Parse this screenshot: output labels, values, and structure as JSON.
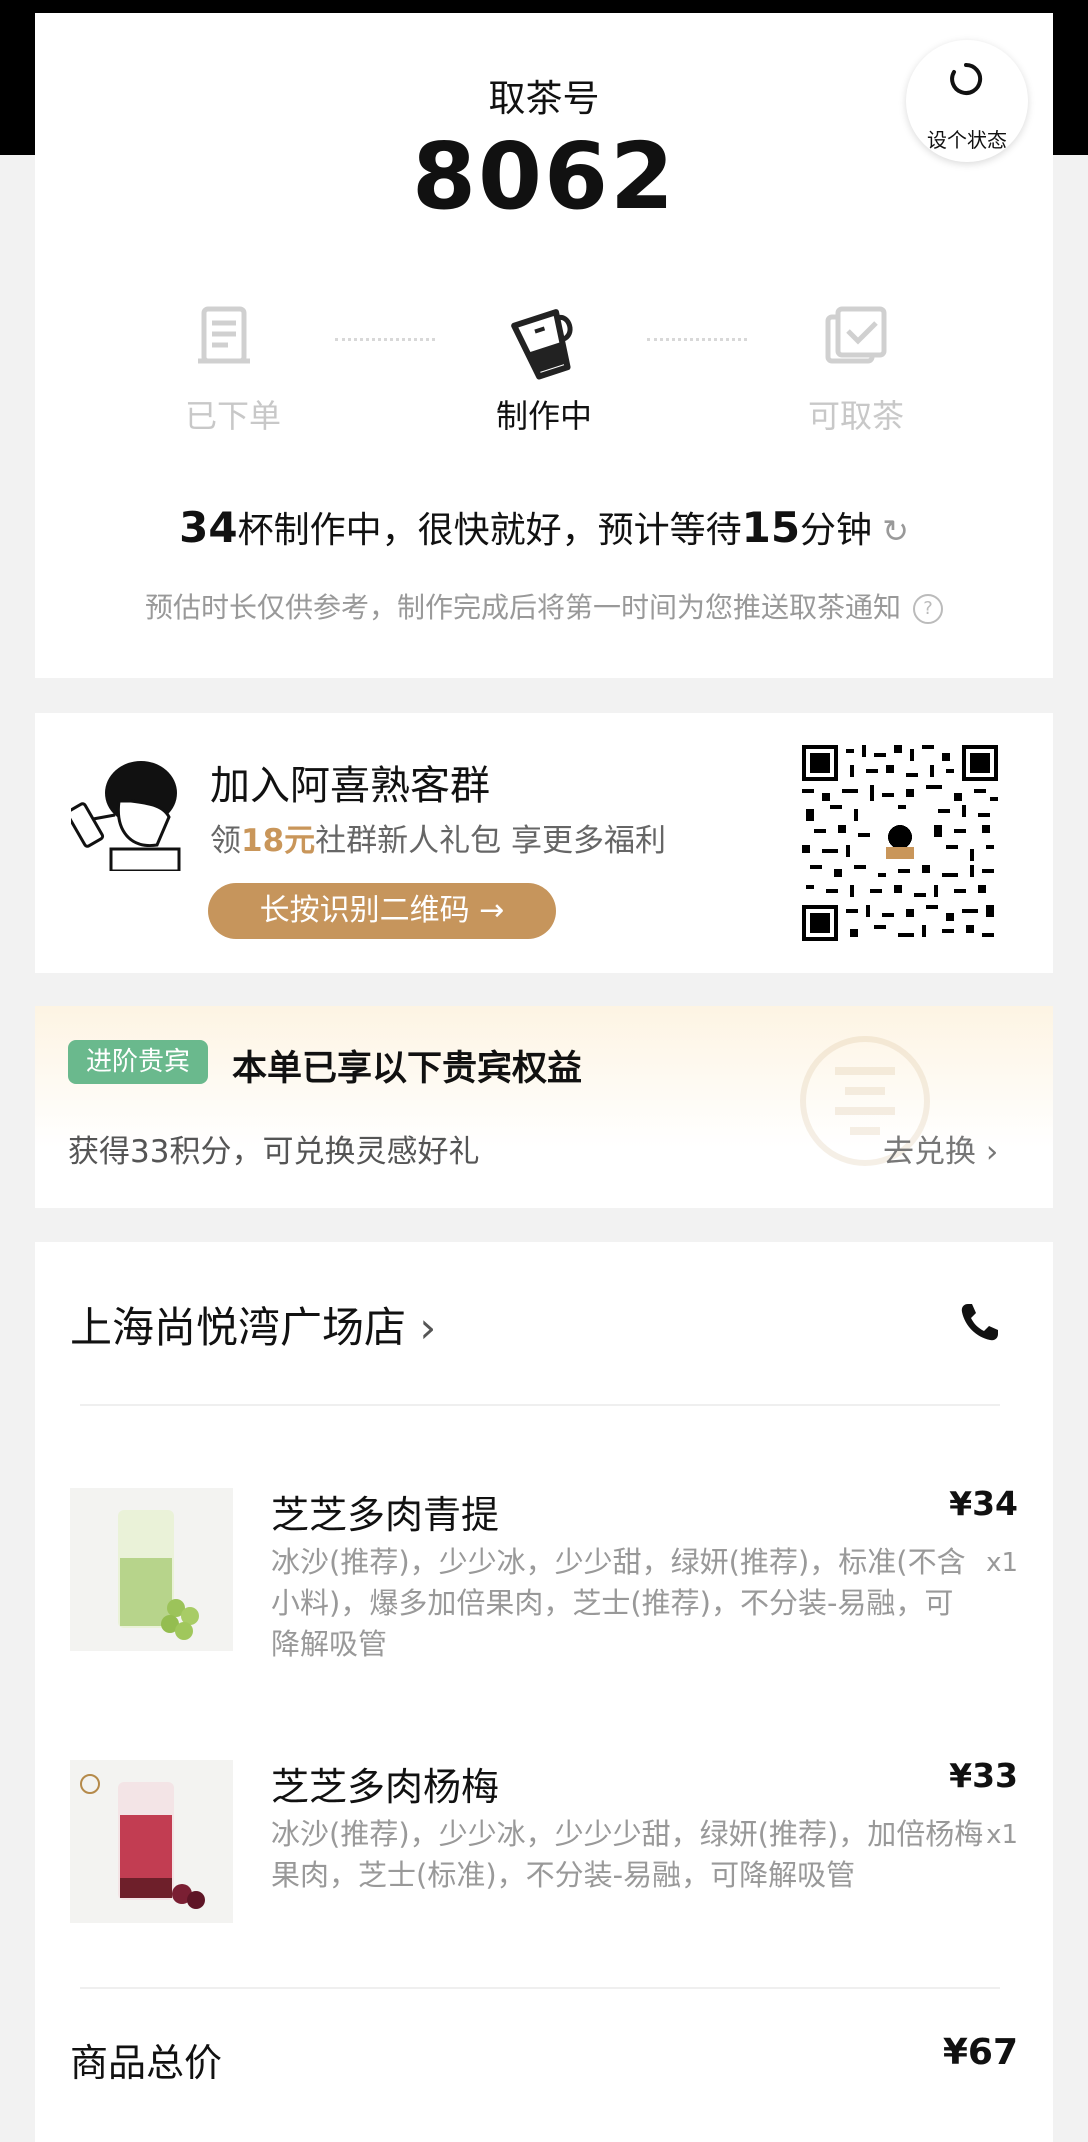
{
  "order": {
    "pickup_label": "取茶号",
    "pickup_number": "8062",
    "set_status_label": "设个状态",
    "steps": [
      {
        "label": "已下单",
        "icon": "receipt-icon"
      },
      {
        "label": "制作中",
        "icon": "shaker-cup-icon"
      },
      {
        "label": "可取茶",
        "icon": "check-box-icon"
      }
    ],
    "active_step": 1,
    "wait": {
      "cups": "34",
      "t1": "杯制作中，很快就好，预计等待",
      "minutes": "15",
      "t2": "分钟"
    },
    "note": "预估时长仅供参考，制作完成后将第一时间为您推送取茶通知"
  },
  "group": {
    "title": "加入阿喜熟客群",
    "sub_prefix": "领",
    "sub_highlight": "18元",
    "sub_suffix": "社群新人礼包 享更多福利",
    "button": "长按识别二维码 →"
  },
  "vip": {
    "tag": "进阶贵宾",
    "title": "本单已享以下贵宾权益",
    "benefit": "获得33积分，可兑换灵感好礼",
    "link": "去兑换"
  },
  "store": {
    "name": "上海尚悦湾广场店"
  },
  "items": [
    {
      "name": "芝芝多肉青提",
      "price": "¥34",
      "qty": "x1",
      "options": "冰沙(推荐)，少少冰，少少甜，绿妍(推荐)，标准(不含小料)，爆多加倍果肉，芝士(推荐)，不分装-易融，可降解吸管"
    },
    {
      "name": "芝芝多肉杨梅",
      "price": "¥33",
      "qty": "x1",
      "options": "冰沙(推荐)，少少冰，少少少甜，绿妍(推荐)，加倍杨梅果肉，芝士(标准)，不分装-易融，可降解吸管"
    }
  ],
  "total": {
    "label": "商品总价",
    "value": "¥67"
  },
  "colors": {
    "accent": "#c6955c",
    "vip_tag": "#6ab98d",
    "muted": "#999999"
  }
}
